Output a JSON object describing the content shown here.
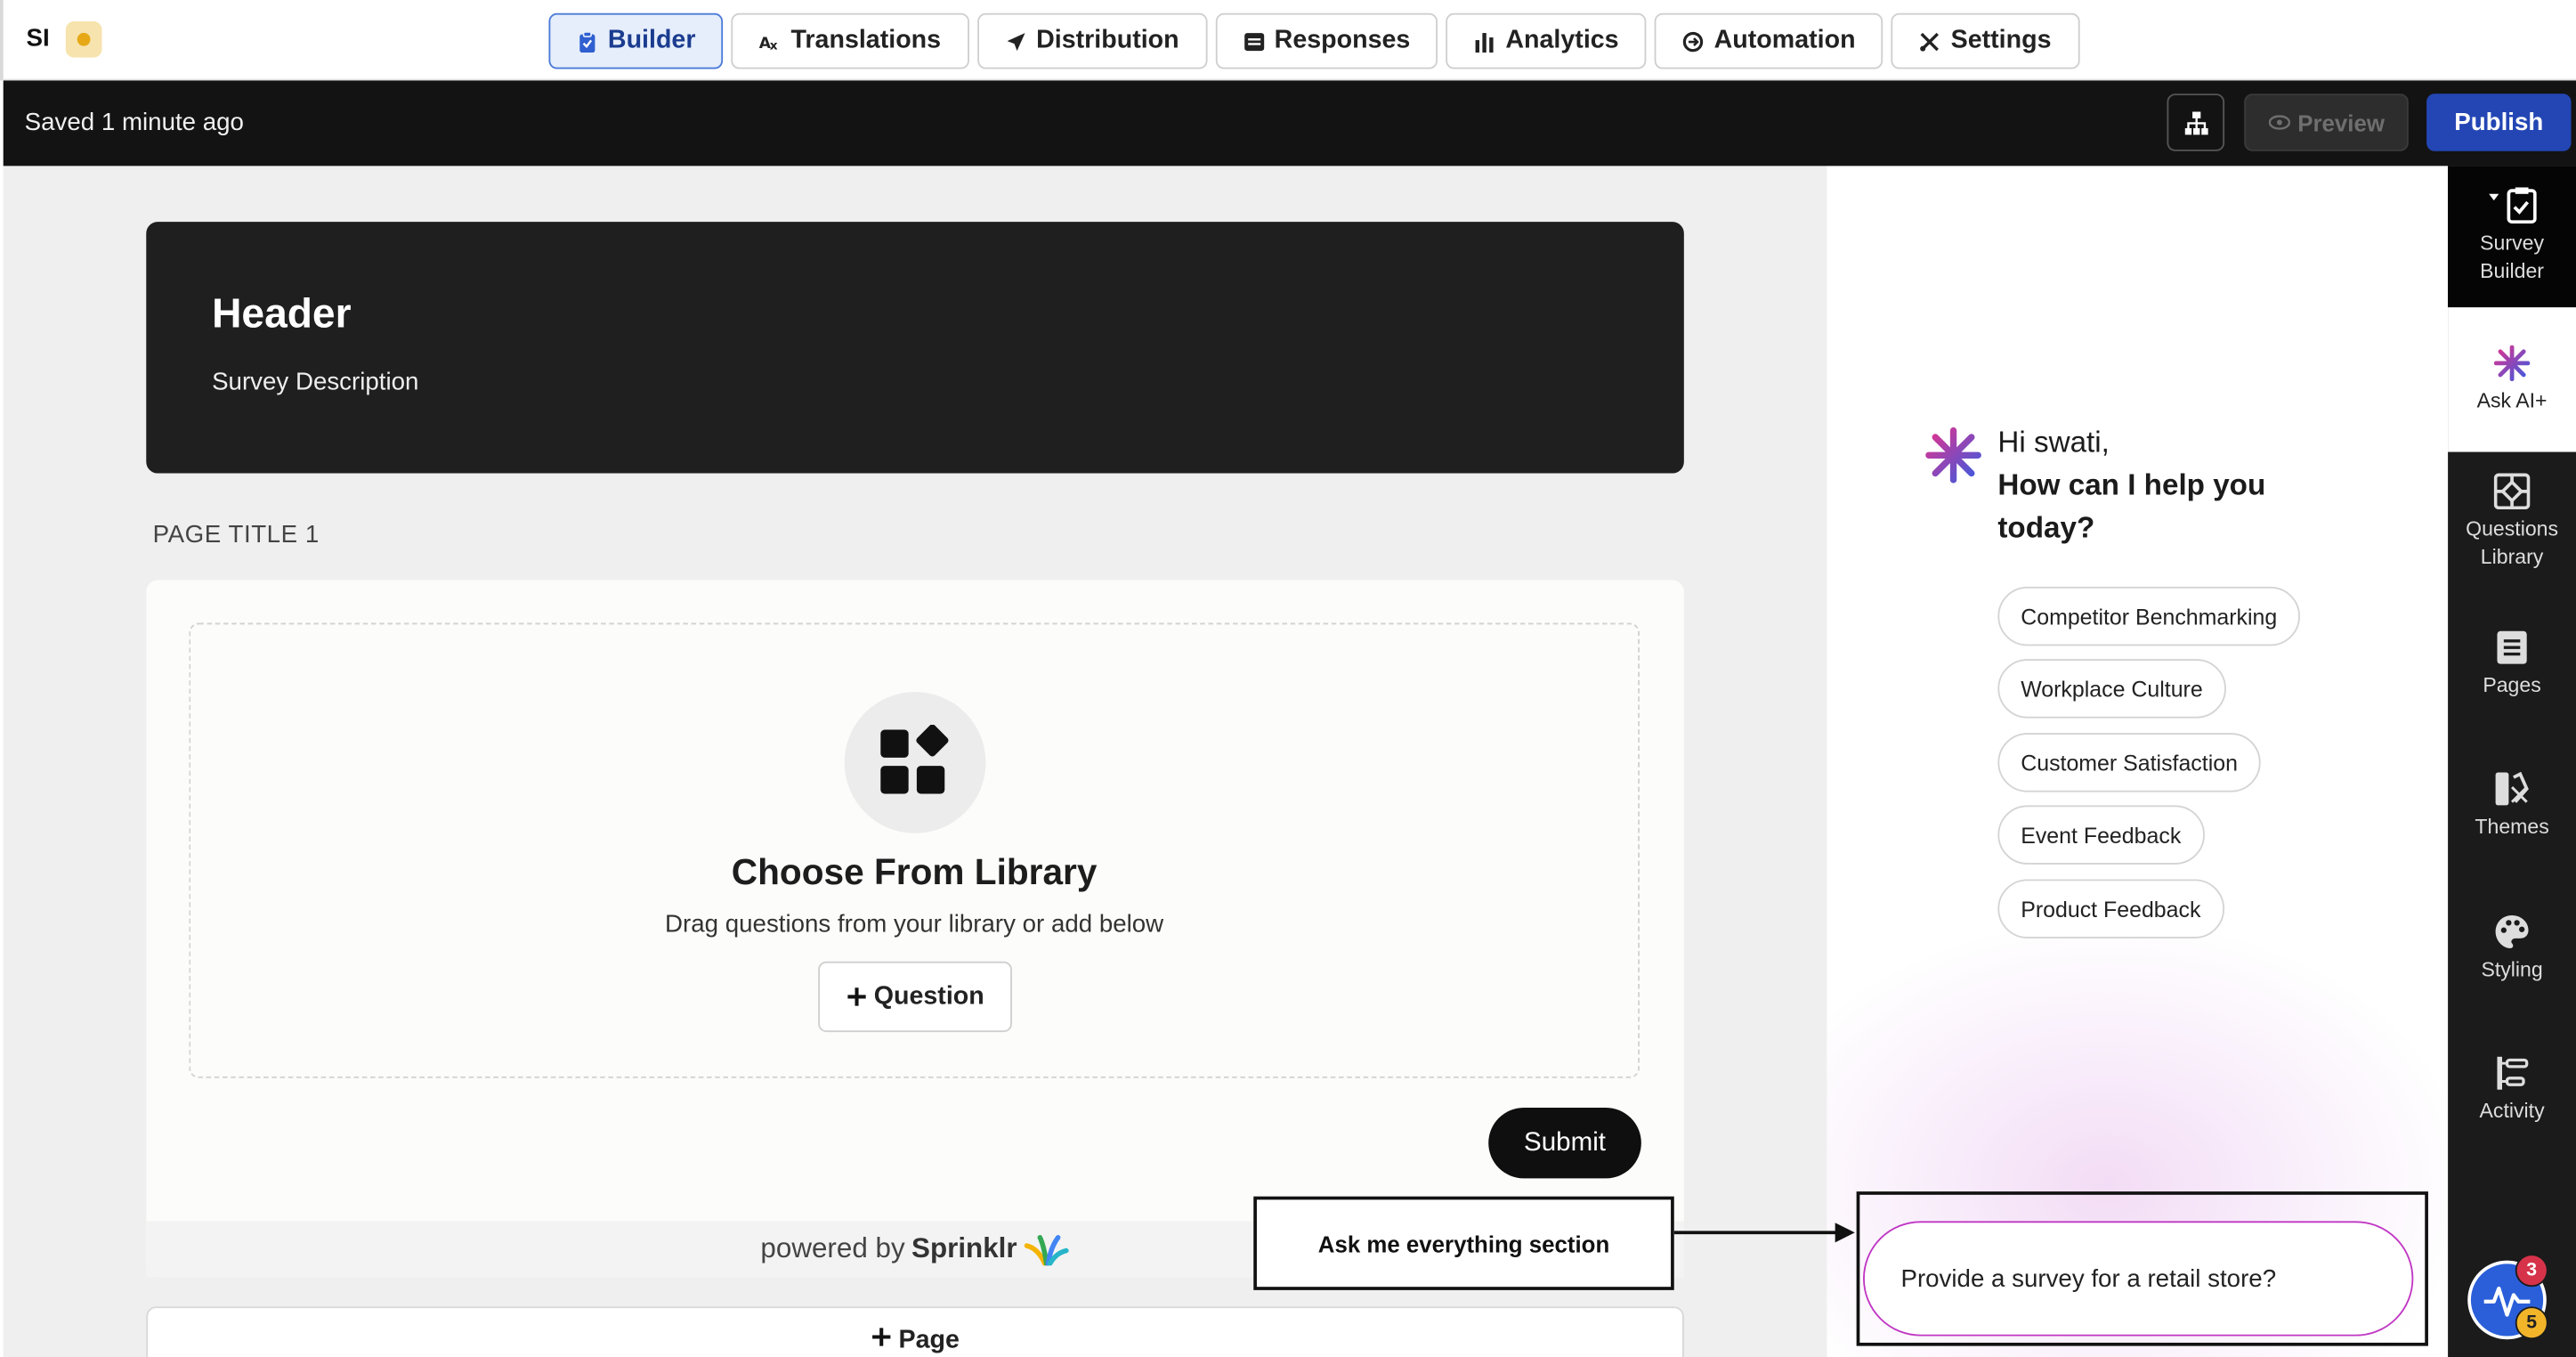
{
  "app": {
    "brand_initials": "SI"
  },
  "tabs": [
    {
      "label": "Builder",
      "icon": "clipboard-icon",
      "active": true
    },
    {
      "label": "Translations",
      "icon": "translate-icon",
      "active": false
    },
    {
      "label": "Distribution",
      "icon": "send-icon",
      "active": false
    },
    {
      "label": "Responses",
      "icon": "list-icon",
      "active": false
    },
    {
      "label": "Analytics",
      "icon": "bar-chart-icon",
      "active": false
    },
    {
      "label": "Automation",
      "icon": "automation-icon",
      "active": false
    },
    {
      "label": "Settings",
      "icon": "tools-icon",
      "active": false
    }
  ],
  "toolbar": {
    "saved_status": "Saved 1 minute ago",
    "preview_label": "Preview",
    "publish_label": "Publish"
  },
  "survey": {
    "header_title": "Header",
    "header_description": "Survey Description",
    "page_title": "PAGE TITLE 1",
    "library_title": "Choose From Library",
    "library_subtitle": "Drag questions from your library or add below",
    "add_question_label": "Question",
    "submit_label": "Submit",
    "powered_by_prefix": "powered by",
    "powered_by_brand": "Sprinklr",
    "add_page_label": "Page"
  },
  "annotation": {
    "callout_text": "Ask me everything section"
  },
  "ai": {
    "greeting": "Hi swati,",
    "question": "How can I help you today?",
    "suggestions": [
      "Competitor Benchmarking",
      "Workplace Culture",
      "Customer Satisfaction",
      "Event Feedback",
      "Product Feedback"
    ],
    "input_value": "Provide a survey for a retail store?"
  },
  "rail": [
    {
      "label": "Survey Builder",
      "icon": "clipboard-check-icon"
    },
    {
      "label": "Ask AI+",
      "icon": "sparkle-icon"
    },
    {
      "label": "Questions Library",
      "icon": "library-icon"
    },
    {
      "label": "Pages",
      "icon": "pages-icon"
    },
    {
      "label": "Themes",
      "icon": "themes-icon"
    },
    {
      "label": "Styling",
      "icon": "palette-icon"
    },
    {
      "label": "Activity",
      "icon": "activity-icon"
    }
  ],
  "notifications": {
    "badge_top": "3",
    "badge_bottom": "5"
  },
  "colors": {
    "accent": "#2346b4",
    "ai_border": "#c037c4",
    "active_tab_bg": "#e6eefc"
  }
}
